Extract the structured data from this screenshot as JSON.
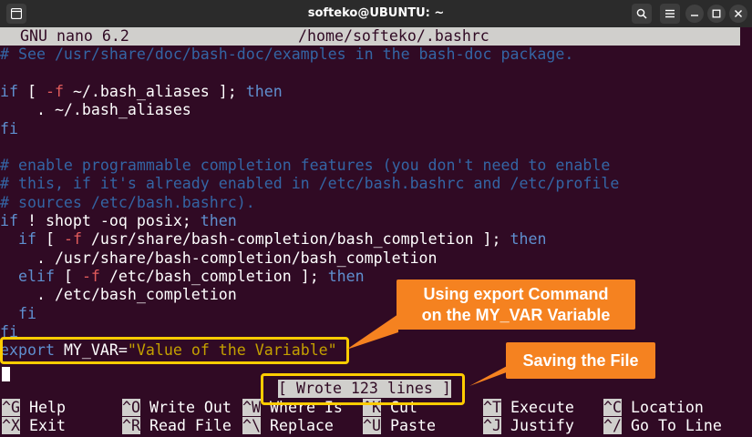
{
  "window": {
    "title": "softeko@UBUNTU: ~"
  },
  "nano": {
    "version": "GNU nano 6.2",
    "filepath": "/home/softeko/.bashrc"
  },
  "lines": [
    {
      "row": 1,
      "segs": [
        {
          "c": "comment",
          "t": "# See /usr/share/doc/bash-doc/examples in the bash-doc package."
        }
      ]
    },
    {
      "row": 2,
      "segs": []
    },
    {
      "row": 3,
      "segs": [
        {
          "c": "kw",
          "t": "if"
        },
        {
          "c": "txt",
          "t": " [ "
        },
        {
          "c": "op",
          "t": "-f"
        },
        {
          "c": "txt",
          "t": " ~/.bash_aliases ]; "
        },
        {
          "c": "kw",
          "t": "then"
        }
      ]
    },
    {
      "row": 4,
      "segs": [
        {
          "c": "txt",
          "t": "    . ~/.bash_aliases"
        }
      ]
    },
    {
      "row": 5,
      "segs": [
        {
          "c": "kw",
          "t": "fi"
        }
      ]
    },
    {
      "row": 6,
      "segs": []
    },
    {
      "row": 7,
      "segs": [
        {
          "c": "comment",
          "t": "# enable programmable completion features (you don't need to enable"
        }
      ]
    },
    {
      "row": 8,
      "segs": [
        {
          "c": "comment",
          "t": "# this, if it's already enabled in /etc/bash.bashrc and /etc/profile"
        }
      ]
    },
    {
      "row": 9,
      "segs": [
        {
          "c": "comment",
          "t": "# sources /etc/bash.bashrc)."
        }
      ]
    },
    {
      "row": 10,
      "segs": [
        {
          "c": "kw",
          "t": "if"
        },
        {
          "c": "txt",
          "t": " ! shopt -oq posix; "
        },
        {
          "c": "kw",
          "t": "then"
        }
      ]
    },
    {
      "row": 11,
      "segs": [
        {
          "c": "txt",
          "t": "  "
        },
        {
          "c": "kw",
          "t": "if"
        },
        {
          "c": "txt",
          "t": " [ "
        },
        {
          "c": "op",
          "t": "-f"
        },
        {
          "c": "txt",
          "t": " /usr/share/bash-completion/bash_completion ]; "
        },
        {
          "c": "kw",
          "t": "then"
        }
      ]
    },
    {
      "row": 12,
      "segs": [
        {
          "c": "txt",
          "t": "    . /usr/share/bash-completion/bash_completion"
        }
      ]
    },
    {
      "row": 13,
      "segs": [
        {
          "c": "txt",
          "t": "  "
        },
        {
          "c": "kw",
          "t": "elif"
        },
        {
          "c": "txt",
          "t": " [ "
        },
        {
          "c": "op",
          "t": "-f"
        },
        {
          "c": "txt",
          "t": " /etc/bash_completion ]; "
        },
        {
          "c": "kw",
          "t": "then"
        }
      ]
    },
    {
      "row": 14,
      "segs": [
        {
          "c": "txt",
          "t": "    . /etc/bash_completion"
        }
      ]
    },
    {
      "row": 15,
      "segs": [
        {
          "c": "txt",
          "t": "  "
        },
        {
          "c": "kw",
          "t": "fi"
        }
      ]
    },
    {
      "row": 16,
      "segs": [
        {
          "c": "kw",
          "t": "fi"
        }
      ]
    },
    {
      "row": 17,
      "segs": [
        {
          "c": "kw",
          "t": "export"
        },
        {
          "c": "txt",
          "t": " MY_VAR="
        },
        {
          "c": "str",
          "t": "\"Value of the Variable\""
        }
      ]
    }
  ],
  "status": {
    "message": "[ Wrote 123 lines ]"
  },
  "shortcuts": [
    {
      "key": "^G",
      "label": "Help"
    },
    {
      "key": "^O",
      "label": "Write Out"
    },
    {
      "key": "^W",
      "label": "Where Is"
    },
    {
      "key": "^K",
      "label": "Cut"
    },
    {
      "key": "^T",
      "label": "Execute"
    },
    {
      "key": "^C",
      "label": "Location"
    },
    {
      "key": "^X",
      "label": "Exit"
    },
    {
      "key": "^R",
      "label": "Read File"
    },
    {
      "key": "^\\",
      "label": "Replace"
    },
    {
      "key": "^U",
      "label": "Paste"
    },
    {
      "key": "^J",
      "label": "Justify"
    },
    {
      "key": "^/",
      "label": "Go To Line"
    }
  ],
  "annotations": {
    "export_callout": "Using export Command on the MY_VAR Variable",
    "save_callout": "Saving the File"
  },
  "colors": {
    "background": "#300a24",
    "comment": "#3465a4",
    "keyword": "#5f8fcf",
    "option": "#e05b5b",
    "string": "#c4a000",
    "highlight": "#ffcc00",
    "callout": "#f58220"
  }
}
